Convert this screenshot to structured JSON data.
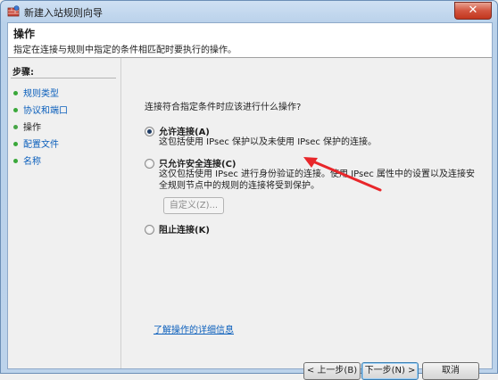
{
  "window": {
    "title": "新建入站规则向导",
    "close_glyph": "✕"
  },
  "header": {
    "title": "操作",
    "description": "指定在连接与规则中指定的条件相匹配时要执行的操作。"
  },
  "steps": {
    "title": "步骤:",
    "items": [
      {
        "label": "规则类型",
        "active": false
      },
      {
        "label": "协议和端口",
        "active": false
      },
      {
        "label": "操作",
        "active": true
      },
      {
        "label": "配置文件",
        "active": false
      },
      {
        "label": "名称",
        "active": false
      }
    ]
  },
  "main": {
    "prompt": "连接符合指定条件时应该进行什么操作?",
    "options": [
      {
        "label": "允许连接(A)",
        "description": "这包括使用 IPsec 保护以及未使用 IPsec 保护的连接。",
        "checked": true
      },
      {
        "label": "只允许安全连接(C)",
        "description": "这仅包括使用 IPsec 进行身份验证的连接。使用 IPsec 属性中的设置以及连接安全规则节点中的规则的连接将受到保护。",
        "checked": false
      },
      {
        "label": "阻止连接(K)",
        "description": "",
        "checked": false
      }
    ],
    "custom_button": "自定义(Z)...",
    "help_link": "了解操作的详细信息"
  },
  "footer": {
    "back": "< 上一步(B)",
    "next": "下一步(N) >",
    "cancel": "取消"
  },
  "colors": {
    "link": "#0b5fbc",
    "annotation_arrow": "#e8262a",
    "step_dot": "#3aa83a"
  }
}
